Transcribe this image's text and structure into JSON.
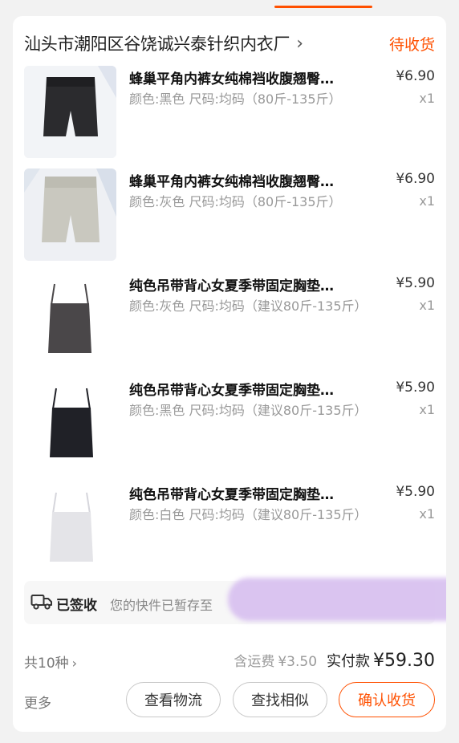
{
  "colors": {
    "accent": "#ff5000",
    "card": "#ffffff",
    "background": "#f2f2f2",
    "muted": "#999999"
  },
  "shop": {
    "name": "汕头市潮阳区谷饶诚兴泰针织内衣厂",
    "chevron": "›",
    "status": "待收货"
  },
  "items": [
    {
      "title": "蜂巢平角内裤女纯棉裆收腹翘臀…",
      "spec": "颜色:黑色 尺码:均码（80斤-135斤）",
      "price": "¥6.90",
      "qty": "x1",
      "thumb_icon": "shorts-black-icon",
      "thumb_color": "#2b2b2e"
    },
    {
      "title": "蜂巢平角内裤女纯棉裆收腹翘臀…",
      "spec": "颜色:灰色 尺码:均码（80斤-135斤）",
      "price": "¥6.90",
      "qty": "x1",
      "thumb_icon": "shorts-gray-icon",
      "thumb_color": "#c9c8bf"
    },
    {
      "title": "纯色吊带背心女夏季带固定胸垫…",
      "spec": "颜色:灰色 尺码:均码（建议80斤-135斤）",
      "price": "¥5.90",
      "qty": "x1",
      "thumb_icon": "camisole-gray-icon",
      "thumb_color": "#4a4749"
    },
    {
      "title": "纯色吊带背心女夏季带固定胸垫…",
      "spec": "颜色:黑色 尺码:均码（建议80斤-135斤）",
      "price": "¥5.90",
      "qty": "x1",
      "thumb_icon": "camisole-black-icon",
      "thumb_color": "#202127"
    },
    {
      "title": "纯色吊带背心女夏季带固定胸垫…",
      "spec": "颜色:白色 尺码:均码（建议80斤-135斤）",
      "price": "¥5.90",
      "qty": "x1",
      "thumb_icon": "camisole-white-icon",
      "thumb_color": "#e4e4e8"
    }
  ],
  "logistics": {
    "icon": "truck-icon",
    "status": "已签收",
    "message": "您的快件已暂存至"
  },
  "summary": {
    "kinds": "共10种",
    "kinds_chevron": "›",
    "shipping_label": "含运费",
    "shipping_value": "¥3.50",
    "paid_label": "实付款",
    "paid_value": "¥59.30"
  },
  "actions": {
    "more": "更多",
    "view_logistics": "查看物流",
    "find_similar": "查找相似",
    "confirm_receipt": "确认收货"
  }
}
